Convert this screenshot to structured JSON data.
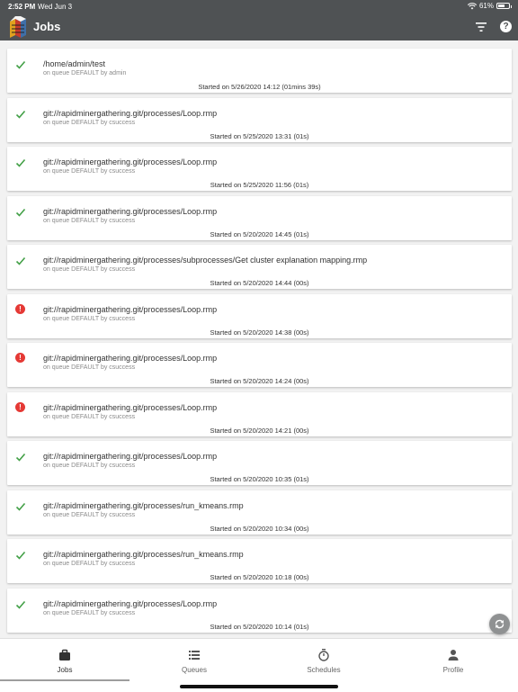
{
  "status_bar": {
    "time": "2:52 PM",
    "date": "Wed Jun 3",
    "battery": "61%",
    "wifi_icon": "wifi-icon"
  },
  "app_bar": {
    "title": "Jobs",
    "actions": [
      "filter-icon",
      "help-icon"
    ]
  },
  "colors": {
    "header": "#4f5254",
    "success": "#43a047",
    "error": "#e53935",
    "background": "#f2f2f2"
  },
  "jobs": [
    {
      "status": "success",
      "path": "/home/admin/test",
      "queue": "on queue DEFAULT by admin",
      "started": "Started on 5/26/2020 14:12   (01mins 39s)"
    },
    {
      "status": "success",
      "path": "git://rapidminergathering.git/processes/Loop.rmp",
      "queue": "on queue DEFAULT by csuccess",
      "started": "Started on 5/25/2020 13:31   (01s)"
    },
    {
      "status": "success",
      "path": "git://rapidminergathering.git/processes/Loop.rmp",
      "queue": "on queue DEFAULT by csuccess",
      "started": "Started on 5/25/2020 11:56   (01s)"
    },
    {
      "status": "success",
      "path": "git://rapidminergathering.git/processes/Loop.rmp",
      "queue": "on queue DEFAULT by csuccess",
      "started": "Started on 5/20/2020 14:45   (01s)"
    },
    {
      "status": "success",
      "path": "git://rapidminergathering.git/processes/subprocesses/Get cluster explanation mapping.rmp",
      "queue": "on queue DEFAULT by csuccess",
      "started": "Started on 5/20/2020 14:44   (00s)"
    },
    {
      "status": "error",
      "path": "git://rapidminergathering.git/processes/Loop.rmp",
      "queue": "on queue DEFAULT by csuccess",
      "started": "Started on 5/20/2020 14:38   (00s)"
    },
    {
      "status": "error",
      "path": "git://rapidminergathering.git/processes/Loop.rmp",
      "queue": "on queue DEFAULT by csuccess",
      "started": "Started on 5/20/2020 14:24   (00s)"
    },
    {
      "status": "error",
      "path": "git://rapidminergathering.git/processes/Loop.rmp",
      "queue": "on queue DEFAULT by csuccess",
      "started": "Started on 5/20/2020 14:21   (00s)"
    },
    {
      "status": "success",
      "path": "git://rapidminergathering.git/processes/Loop.rmp",
      "queue": "on queue DEFAULT by csuccess",
      "started": "Started on 5/20/2020 10:35   (01s)"
    },
    {
      "status": "success",
      "path": "git://rapidminergathering.git/processes/run_kmeans.rmp",
      "queue": "on queue DEFAULT by csuccess",
      "started": "Started on 5/20/2020 10:34   (00s)"
    },
    {
      "status": "success",
      "path": "git://rapidminergathering.git/processes/run_kmeans.rmp",
      "queue": "on queue DEFAULT by csuccess",
      "started": "Started on 5/20/2020 10:18   (00s)"
    },
    {
      "status": "success",
      "path": "git://rapidminergathering.git/processes/Loop.rmp",
      "queue": "on queue DEFAULT by csuccess",
      "started": "Started on 5/20/2020 10:14   (01s)"
    }
  ],
  "refresh_button": {
    "icon": "refresh-icon"
  },
  "bottom_nav": [
    {
      "label": "Jobs",
      "icon": "briefcase-icon",
      "active": true
    },
    {
      "label": "Queues",
      "icon": "list-icon",
      "active": false
    },
    {
      "label": "Schedules",
      "icon": "timer-icon",
      "active": false
    },
    {
      "label": "Profile",
      "icon": "person-icon",
      "active": false
    }
  ]
}
